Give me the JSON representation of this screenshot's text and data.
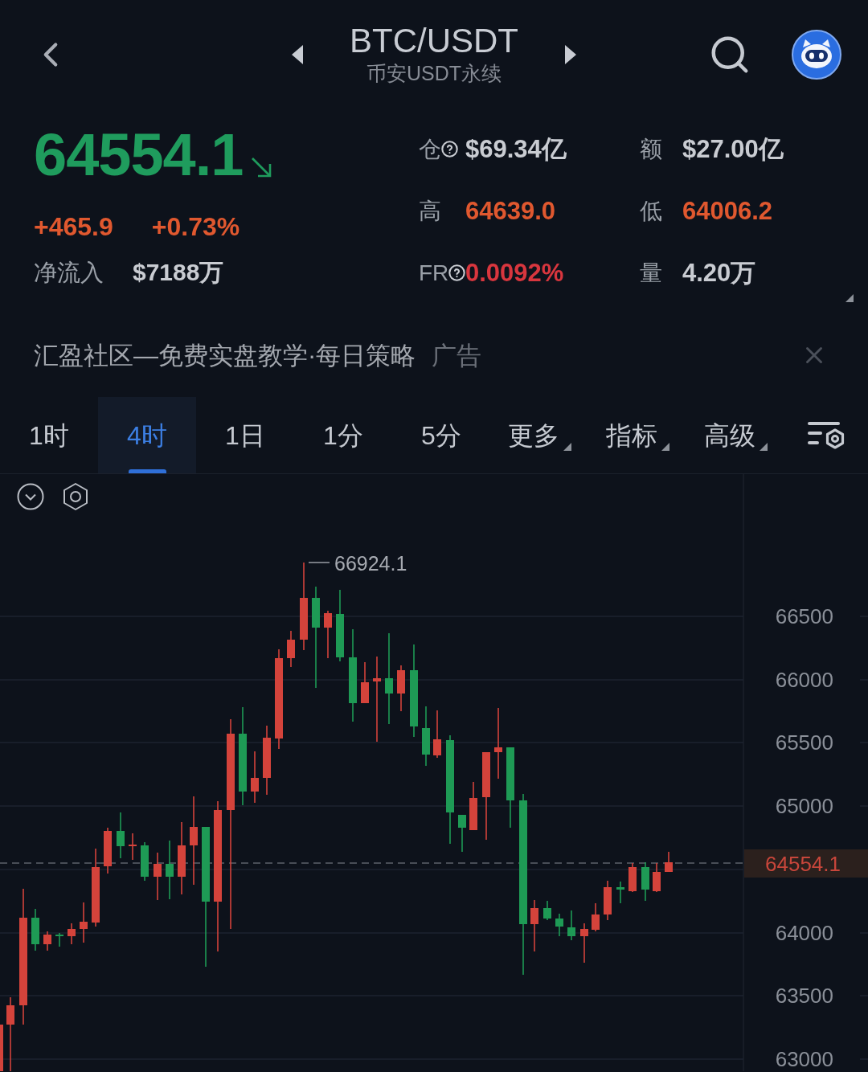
{
  "header": {
    "title": "BTC/USDT",
    "subtitle": "币安USDT永续"
  },
  "ticker": {
    "price": "64554.1",
    "rising": false,
    "change": "+465.9",
    "change_percent": "+0.73%",
    "net_inflow": {
      "label": "净流入",
      "value": "$7188万"
    }
  },
  "stats": [
    {
      "label": "仓",
      "help": true,
      "value": "$69.34亿",
      "color": "#c9ccd2"
    },
    {
      "label": "额",
      "help": false,
      "value": "$27.00亿",
      "color": "#c9ccd2"
    },
    {
      "label": "高",
      "help": false,
      "value": "64639.0",
      "color": "#e0582f"
    },
    {
      "label": "低",
      "help": false,
      "value": "64006.2",
      "color": "#e0582f"
    },
    {
      "label": "FR",
      "help": true,
      "value": "0.0092%",
      "color": "#d8363e"
    },
    {
      "label": "量",
      "help": false,
      "value": "4.20万",
      "color": "#c9ccd2"
    }
  ],
  "ad": {
    "text": "汇盈社区—免费实盘教学·每日策略",
    "tag": "广告"
  },
  "intervals": [
    {
      "label": "1时",
      "selected": false,
      "dropdown": false
    },
    {
      "label": "4时",
      "selected": true,
      "dropdown": false
    },
    {
      "label": "1日",
      "selected": false,
      "dropdown": false
    },
    {
      "label": "1分",
      "selected": false,
      "dropdown": false
    },
    {
      "label": "5分",
      "selected": false,
      "dropdown": false
    },
    {
      "label": "更多",
      "selected": false,
      "dropdown": true
    },
    {
      "label": "指标",
      "selected": false,
      "dropdown": true
    },
    {
      "label": "高级",
      "selected": false,
      "dropdown": true
    }
  ],
  "chart": {
    "high_label": "66924.1",
    "y_axis": [
      "66500",
      "66000",
      "65500",
      "65000",
      "64000",
      "63500",
      "63000"
    ],
    "last_price": "64554.1"
  }
}
